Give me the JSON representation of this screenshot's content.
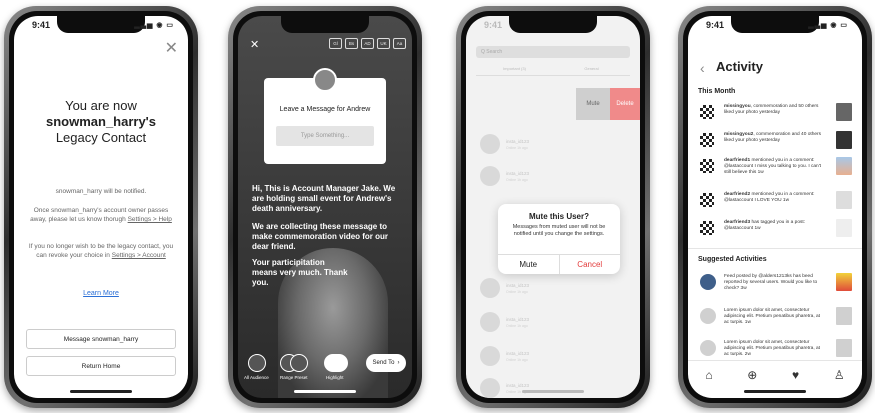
{
  "status": {
    "time": "9:41"
  },
  "legacy": {
    "title_line1": "You are now",
    "title_user": "snowman_harry's",
    "title_line3": "Legacy Contact",
    "notified": "snowman_harry will be notified.",
    "para1": "Once snowman_harry's account owner passes away, please let us know thorugh",
    "para1_link": "Settings > Help",
    "para2": "If you no longer wish to be the legacy contact, you can revoke your choice in",
    "para2_link": "Settings > Account",
    "learn_more": "Learn More",
    "message_button": "Message snowman_harry",
    "home_button": "Return Home"
  },
  "story": {
    "tools": [
      "Gl",
      "Bs",
      "AD",
      "UK",
      "Aa"
    ],
    "card_title": "Leave a Message for Andrew",
    "placeholder": "Type Something...",
    "text1": "Hi, This is Account Manager Jake. We are holding small event for Andrew's death anniversary.",
    "text2": "We are collecting these message to make commemoration video for our dear friend.",
    "text3": "Your participitation means very much. Thank you.",
    "bottom_labels": [
      "All Audience",
      "Range Preset",
      "Highlight"
    ],
    "send": "Send To"
  },
  "mute": {
    "search": "Q  Search",
    "tabs": [
      "Important (3)",
      "General"
    ],
    "swipe_mute": "Mute",
    "swipe_delete": "Delete",
    "row_name": "insta_id123",
    "row_sub": "Online 1h ago",
    "dialog_title": "Mute this User?",
    "dialog_msg": "Messages from muted user will not be notified until you change the settings.",
    "dialog_mute": "Mute",
    "dialog_cancel": "Cancel"
  },
  "activity": {
    "title": "Activity",
    "section_month": "This Month",
    "items": [
      {
        "user": "missingyou",
        "text": ", commemoration and 50 others liked your photo yesterday"
      },
      {
        "user": "missingyou2",
        "text": ", commemoration and 40 others liked your photo yesterday"
      },
      {
        "user": "dearfriend1",
        "text": " mentioned you in a comment: @lastaccount I miss you talking to you. I can't still believe this 1w"
      },
      {
        "user": "dearfriend2",
        "text": " mentioned you in a comment: @lastaccount I LOVE YOU 1w"
      },
      {
        "user": "dearfriend3",
        "text": " has tagged you in a post: @lastaccount 1w"
      }
    ],
    "section_suggested": "Suggested Activities",
    "suggested": [
      {
        "text": "Feed posted by @alders1213ks has beed reported by several users. Would you like to check? 3w"
      },
      {
        "text": "Lorem ipsum dolor sit amet, consectetur adipiscing elit. Pretium penatibus pharetra, at ac turpis. 1w"
      },
      {
        "text": "Lorem ipsum dolor sit amet, consectetur adipiscing elit. Pretium penatibus pharetra, at ac turpis. 2w"
      }
    ]
  }
}
